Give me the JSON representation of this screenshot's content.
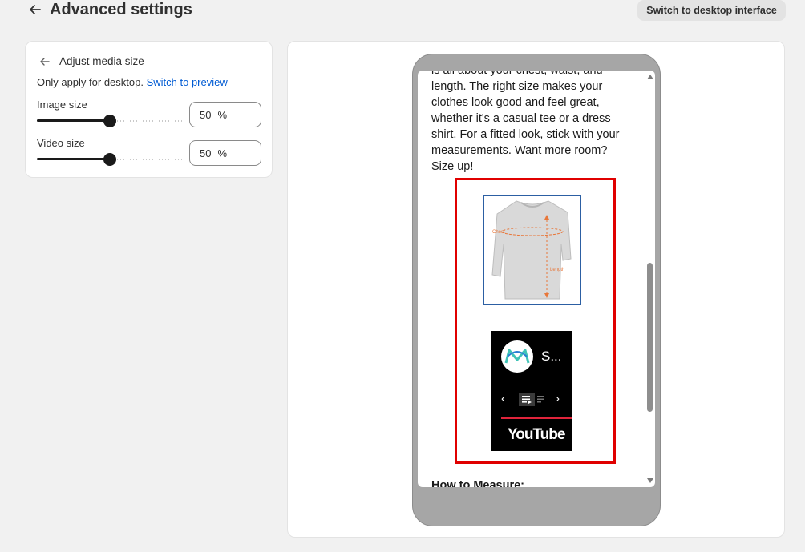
{
  "header": {
    "title": "Advanced settings",
    "desktop_button_label": "Switch to desktop interface"
  },
  "settings": {
    "card_title": "Adjust media size",
    "apply_note": "Only apply for desktop.",
    "preview_link": "Switch to preview",
    "image_size": {
      "label": "Image size",
      "value": "50",
      "unit": "%",
      "slider_percent": 50
    },
    "video_size": {
      "label": "Video size",
      "value": "50",
      "unit": "%",
      "slider_percent": 50
    }
  },
  "preview": {
    "body_text": "is all about your chest, waist, and length. The right size makes your clothes look good and feel great, whether it's a casual tee or a dress shirt. For a fitted look, stick with your measurements. Want more room? Size up!",
    "image_labels": {
      "chest": "Chest",
      "length": "Length"
    },
    "video": {
      "title": "S...",
      "logo_text": "YouTube"
    },
    "next_heading": "How to Measure:"
  },
  "colors": {
    "accent_link": "#005bd3",
    "highlight": "#e00000",
    "youtube_red": "#e0243b"
  },
  "icons": [
    "back-arrow-icon",
    "prev-icon",
    "next-icon",
    "playlist-icon",
    "scroll-up-icon",
    "scroll-down-icon"
  ]
}
